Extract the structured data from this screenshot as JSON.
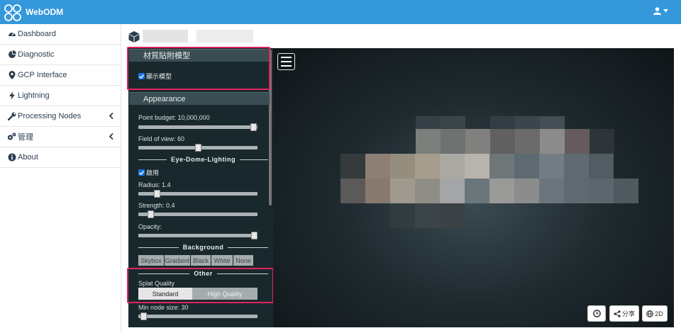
{
  "navbar": {
    "brand": "WebODM"
  },
  "sidebar": {
    "items": [
      {
        "label": "Dashboard",
        "icon": "dashboard-icon"
      },
      {
        "label": "Diagnostic",
        "icon": "pie-chart-icon"
      },
      {
        "label": "GCP Interface",
        "icon": "map-marker-icon"
      },
      {
        "label": "Lightning",
        "icon": "bolt-icon"
      },
      {
        "label": "Processing Nodes",
        "icon": "wrench-icon",
        "expandable": true
      },
      {
        "label": "管理",
        "icon": "cogs-icon",
        "expandable": true
      },
      {
        "label": "About",
        "icon": "info-icon"
      }
    ]
  },
  "panel": {
    "texture_header": "材質貼附模型",
    "show_model_label": "顯示模型",
    "appearance_header": "Appearance",
    "point_budget_label": "Point budget: 10,000,000",
    "point_budget_value": 0.995,
    "fov_label": "Field of view: 60",
    "fov_value": 0.5,
    "edl_title": "Eye-Dome-Lighting",
    "edl_enable_label": "啟用",
    "radius_label": "Radius: 1.4",
    "radius_value": 0.14,
    "strength_label": "Strength: 0.4",
    "strength_value": 0.08,
    "opacity_label": "Opacity:",
    "opacity_value": 1.0,
    "background_title": "Background",
    "background_options": [
      "Skybox",
      "Gradient",
      "Black",
      "White",
      "None"
    ],
    "background_selected": "Gradient",
    "other_title": "Other",
    "splat_label": "Splat Quality",
    "splat_options": [
      "Standard",
      "High Quality"
    ],
    "splat_selected": "Standard",
    "min_node_label": "Min node size: 30",
    "min_node_value": 0.02
  },
  "viewer": {
    "share_label": "分享",
    "view2d_label": "2D"
  },
  "colors": {
    "navbar": "#3498db",
    "panel_bg": "#19282c",
    "highlight": "#e0245e",
    "checkbox": "#1a73e8"
  }
}
